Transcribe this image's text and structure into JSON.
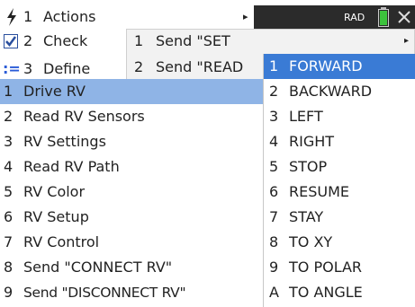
{
  "topbar": {
    "actions_number": "1",
    "actions_label": "Actions",
    "check_number": "2",
    "check_label": "Check",
    "define_number": "3",
    "define_label": "Define",
    "mode": "RAD"
  },
  "send_menu": {
    "items": [
      {
        "number": "1",
        "label": "Send \"SET"
      },
      {
        "number": "2",
        "label": "Send \"READ"
      }
    ]
  },
  "hub_menu": {
    "items": [
      {
        "number": "1",
        "label": "Drive RV"
      },
      {
        "number": "2",
        "label": "Read RV Sensors"
      },
      {
        "number": "3",
        "label": "RV Settings"
      },
      {
        "number": "4",
        "label": "Read RV Path"
      },
      {
        "number": "5",
        "label": "RV Color"
      },
      {
        "number": "6",
        "label": "RV Setup"
      },
      {
        "number": "7",
        "label": "RV Control"
      },
      {
        "number": "8",
        "label": "Send \"CONNECT RV\""
      },
      {
        "number": "9",
        "label": "Send \"DISCONNECT RV\""
      }
    ]
  },
  "drive_menu": {
    "items": [
      {
        "number": "1",
        "label": "FORWARD"
      },
      {
        "number": "2",
        "label": "BACKWARD"
      },
      {
        "number": "3",
        "label": "LEFT"
      },
      {
        "number": "4",
        "label": "RIGHT"
      },
      {
        "number": "5",
        "label": "STOP"
      },
      {
        "number": "6",
        "label": "RESUME"
      },
      {
        "number": "7",
        "label": "STAY"
      },
      {
        "number": "8",
        "label": "TO XY"
      },
      {
        "number": "9",
        "label": "TO POLAR"
      },
      {
        "number": "A",
        "label": "TO ANGLE"
      }
    ]
  },
  "colors": {
    "accent_selected": "#3a7bd5",
    "parent_selected": "#8fb4e6",
    "battery": "#3cc33c"
  },
  "icons": [
    "actions-icon",
    "check-icon",
    "define-icon",
    "battery-icon",
    "close-icon",
    "submenu-arrow-icon"
  ]
}
